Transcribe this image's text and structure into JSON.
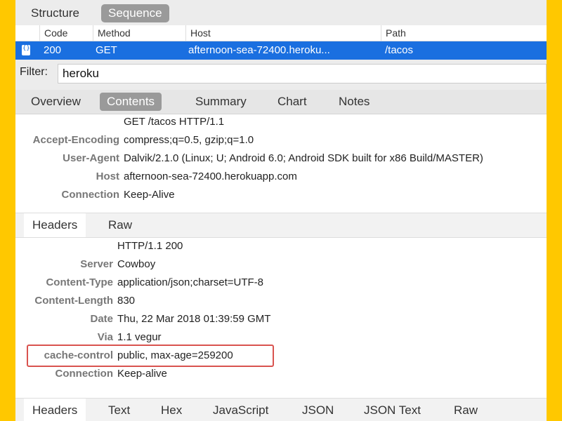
{
  "view_tabs": {
    "structure": "Structure",
    "sequence": "Sequence"
  },
  "table": {
    "columns": [
      "Code",
      "Method",
      "Host",
      "Path"
    ],
    "row": {
      "code": "200",
      "method": "GET",
      "host": "afternoon-sea-72400.heroku...",
      "path": "/tacos"
    }
  },
  "filter": {
    "label": "Filter:",
    "value": "heroku"
  },
  "content_tabs": [
    "Overview",
    "Contents",
    "Summary",
    "Chart",
    "Notes"
  ],
  "request": {
    "first_line": "GET /tacos HTTP/1.1",
    "headers": [
      {
        "key": "Accept-Encoding",
        "value": "compress;q=0.5, gzip;q=1.0"
      },
      {
        "key": "User-Agent",
        "value": "Dalvik/2.1.0 (Linux; U; Android 6.0; Android SDK built for x86 Build/MASTER)"
      },
      {
        "key": "Host",
        "value": "afternoon-sea-72400.herokuapp.com"
      },
      {
        "key": "Connection",
        "value": "Keep-Alive"
      }
    ]
  },
  "request_subtabs": [
    "Headers",
    "Raw"
  ],
  "response": {
    "status_line": "HTTP/1.1 200",
    "headers": [
      {
        "key": "Server",
        "value": "Cowboy"
      },
      {
        "key": "Content-Type",
        "value": "application/json;charset=UTF-8"
      },
      {
        "key": "Content-Length",
        "value": "830"
      },
      {
        "key": "Date",
        "value": "Thu, 22 Mar 2018 01:39:59 GMT"
      },
      {
        "key": "Via",
        "value": "1.1 vegur"
      },
      {
        "key": "cache-control",
        "value": "public, max-age=259200"
      },
      {
        "key": "Connection",
        "value": "Keep-alive"
      }
    ]
  },
  "response_subtabs": [
    "Headers",
    "Text",
    "Hex",
    "JavaScript",
    "JSON",
    "JSON Text",
    "Raw"
  ],
  "colors": {
    "frame": "#FFC800",
    "selection": "#1A6FE0",
    "highlight": "#D9534F"
  }
}
